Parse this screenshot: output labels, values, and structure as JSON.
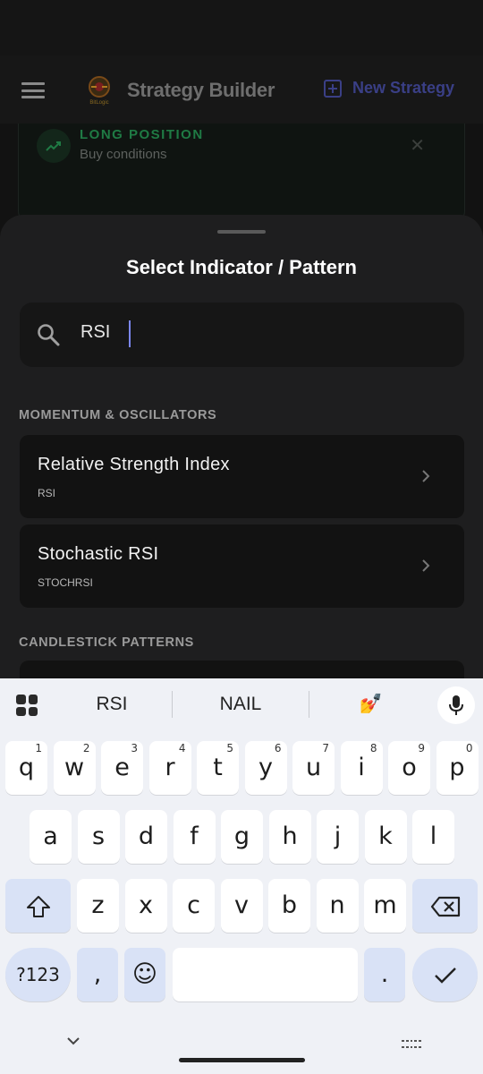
{
  "app_bar": {
    "title": "Strategy Builder",
    "logo_text": "BitLogic",
    "new_strategy_label": "New Strategy"
  },
  "position_card": {
    "title": "LONG POSITION",
    "subtitle": "Buy conditions",
    "close_glyph": "✕"
  },
  "sheet": {
    "title": "Select Indicator / Pattern",
    "search": {
      "value": "RSI",
      "placeholder": ""
    },
    "sections": [
      {
        "label": "MOMENTUM & OSCILLATORS",
        "items": [
          {
            "name": "Relative Strength Index",
            "code": "RSI"
          },
          {
            "name": "Stochastic RSI",
            "code": "STOCHRSI"
          }
        ]
      },
      {
        "label": "CANDLESTICK PATTERNS",
        "items": []
      }
    ]
  },
  "keyboard": {
    "suggestions": [
      "RSI",
      "NAIL",
      "💅"
    ],
    "row1": [
      {
        "letter": "q",
        "num": "1"
      },
      {
        "letter": "w",
        "num": "2"
      },
      {
        "letter": "e",
        "num": "3"
      },
      {
        "letter": "r",
        "num": "4"
      },
      {
        "letter": "t",
        "num": "5"
      },
      {
        "letter": "y",
        "num": "6"
      },
      {
        "letter": "u",
        "num": "7"
      },
      {
        "letter": "i",
        "num": "8"
      },
      {
        "letter": "o",
        "num": "9"
      },
      {
        "letter": "p",
        "num": "0"
      }
    ],
    "row2": [
      "a",
      "s",
      "d",
      "f",
      "g",
      "h",
      "j",
      "k",
      "l"
    ],
    "row3": [
      "z",
      "x",
      "c",
      "v",
      "b",
      "n",
      "m"
    ],
    "symbols_label": "?123",
    "comma_label": ",",
    "emoji_label": "☺",
    "period_label": ".",
    "accent_color": "#7b86f0"
  }
}
